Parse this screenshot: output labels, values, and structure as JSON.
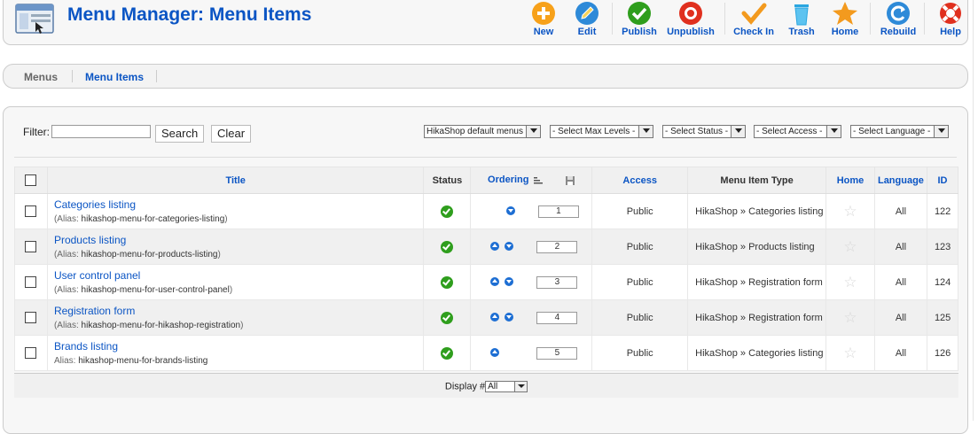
{
  "header": {
    "title": "Menu Manager: Menu Items",
    "logo_icon": "menu-manager-icon"
  },
  "toolbar": {
    "buttons": [
      {
        "label": "New",
        "icon": "plus-icon",
        "color": "#f7a11a"
      },
      {
        "label": "Edit",
        "icon": "pencil-icon",
        "color": "#2e8ad8"
      },
      {
        "label": "Publish",
        "icon": "check-icon",
        "color": "#2f9e1d"
      },
      {
        "label": "Unpublish",
        "icon": "stop-icon",
        "color": "#e0301e"
      },
      {
        "label": "Check In",
        "icon": "checkmark-icon",
        "color": "#f39a1e"
      },
      {
        "label": "Trash",
        "icon": "trash-icon",
        "color": "#2aa6e0"
      },
      {
        "label": "Home",
        "icon": "star-icon",
        "color": "#f39a1e"
      },
      {
        "label": "Rebuild",
        "icon": "refresh-icon",
        "color": "#2e8ad8"
      },
      {
        "label": "Help",
        "icon": "lifebuoy-icon",
        "color": "#e0301e"
      }
    ]
  },
  "submenu": {
    "tabs": [
      {
        "label": "Menus"
      },
      {
        "label": "Menu Items"
      }
    ]
  },
  "filter": {
    "label": "Filter:",
    "value": "",
    "search_label": "Search",
    "clear_label": "Clear",
    "selects": [
      "HikaShop default menus",
      "- Select Max Levels -",
      "- Select Status -",
      "- Select Access -",
      "- Select Language -"
    ]
  },
  "table": {
    "headers": {
      "title": "Title",
      "status": "Status",
      "ordering": "Ordering",
      "access": "Access",
      "type": "Menu Item Type",
      "home": "Home",
      "language": "Language",
      "id": "ID"
    },
    "alias_prefix": "Alias:",
    "rows": [
      {
        "title": "Categories listing",
        "alias": "hikashop-menu-for-categories-listing",
        "order": "1",
        "access": "Public",
        "type": "HikaShop » Categories listing",
        "language": "All",
        "id": "122"
      },
      {
        "title": "Products listing",
        "alias": "hikashop-menu-for-products-listing",
        "order": "2",
        "access": "Public",
        "type": "HikaShop » Products listing",
        "language": "All",
        "id": "123"
      },
      {
        "title": "User control panel",
        "alias": "hikashop-menu-for-user-control-panel",
        "order": "3",
        "access": "Public",
        "type": "HikaShop » Registration form",
        "language": "All",
        "id": "124"
      },
      {
        "title": "Registration form",
        "alias": "hikashop-menu-for-hikashop-registration",
        "order": "4",
        "access": "Public",
        "type": "HikaShop » Registration form",
        "language": "All",
        "id": "125"
      },
      {
        "title": "Brands listing",
        "alias": "hikashop-menu-for-brands-listing",
        "order": "5",
        "access": "Public",
        "type": "HikaShop » Categories listing",
        "language": "All",
        "id": "126"
      }
    ]
  },
  "footer": {
    "display_label": "Display #",
    "display_value": "All"
  }
}
